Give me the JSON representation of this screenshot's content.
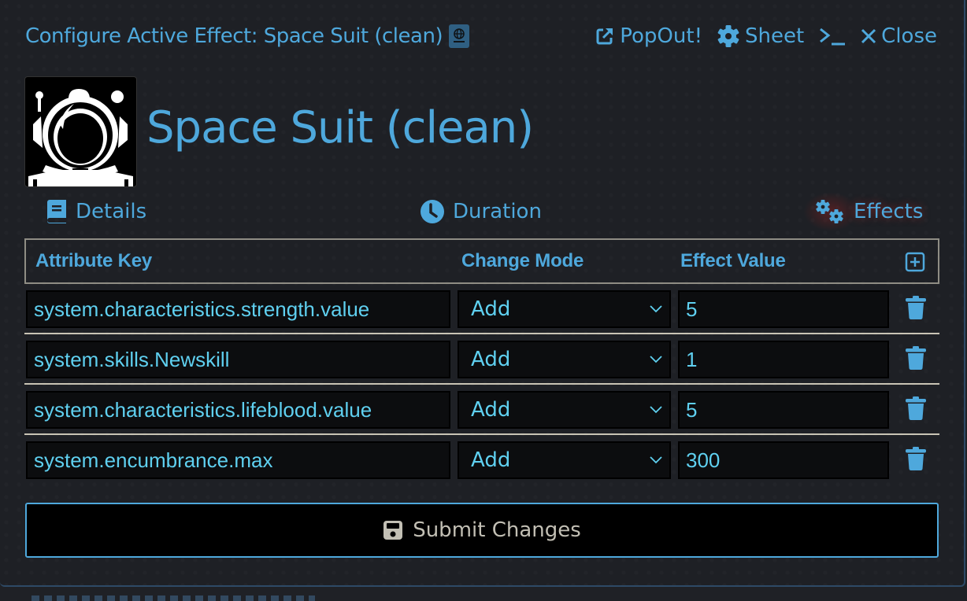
{
  "window": {
    "title": "Configure Active Effect: Space Suit (clean)",
    "actions": [
      {
        "label": "PopOut!",
        "icon": "external-link-icon"
      },
      {
        "label": "Sheet",
        "icon": "gear-icon"
      },
      {
        "label": "",
        "icon": "terminal-icon"
      },
      {
        "label": "Close",
        "icon": "close-icon"
      }
    ]
  },
  "item": {
    "name": "Space Suit (clean)",
    "image": "astronaut-helmet-icon"
  },
  "tabs": [
    {
      "label": "Details",
      "icon": "book-icon",
      "active": false
    },
    {
      "label": "Duration",
      "icon": "clock-icon",
      "active": false
    },
    {
      "label": "Effects",
      "icon": "cogs-icon",
      "active": true
    }
  ],
  "table": {
    "headers": {
      "key": "Attribute Key",
      "mode": "Change Mode",
      "value": "Effect Value"
    },
    "rows": [
      {
        "key": "system.characteristics.strength.value",
        "mode": "Add",
        "value": "5"
      },
      {
        "key": "system.skills.Newskill",
        "mode": "Add",
        "value": "1"
      },
      {
        "key": "system.characteristics.lifeblood.value",
        "mode": "Add",
        "value": "5"
      },
      {
        "key": "system.encumbrance.max",
        "mode": "Add",
        "value": "300"
      }
    ]
  },
  "submit": {
    "label": "Submit Changes",
    "icon": "save-icon"
  },
  "colors": {
    "accent": "#4ea8dc",
    "field_text": "#5fd0f0",
    "background": "#1e2025",
    "separator": "#c9c4b5",
    "submit_text": "#c2bfb4"
  }
}
